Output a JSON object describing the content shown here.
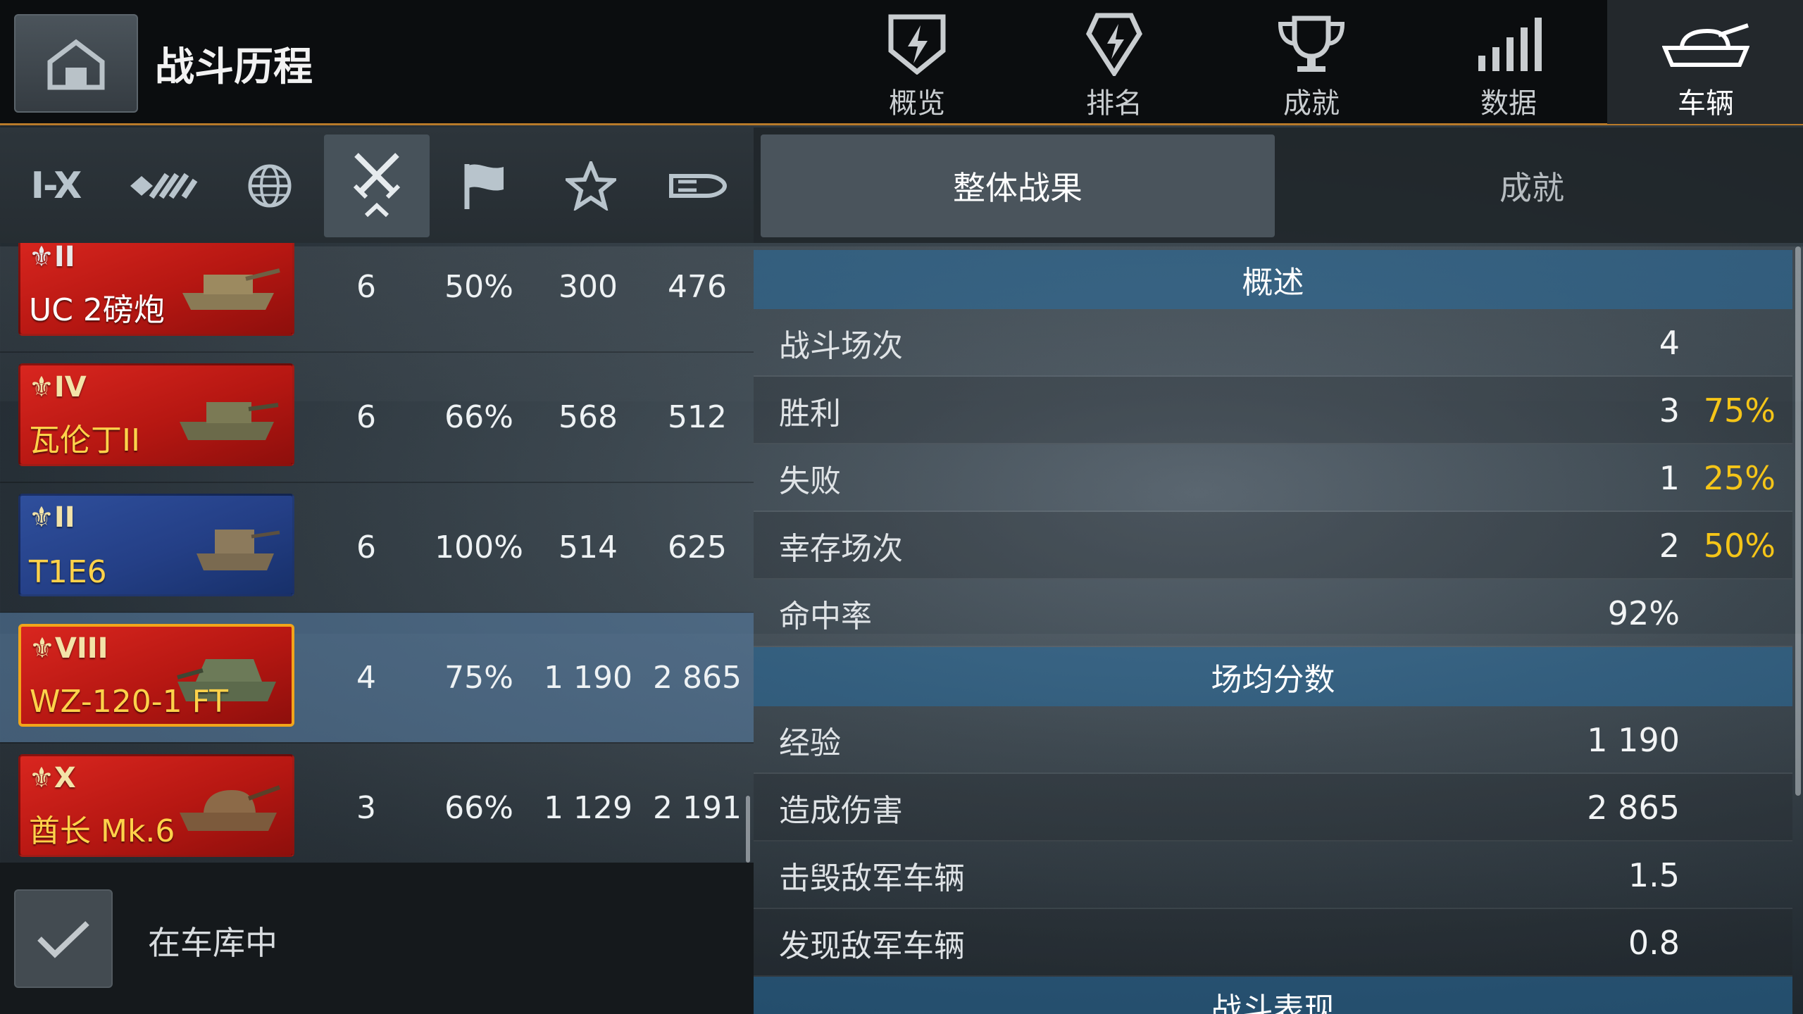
{
  "header": {
    "title": "战斗历程",
    "tabs": [
      {
        "label": "概览",
        "icon": "shield-bolt-icon",
        "active": false
      },
      {
        "label": "排名",
        "icon": "rank-bolt-icon",
        "active": false
      },
      {
        "label": "成就",
        "icon": "trophy-icon",
        "active": false
      },
      {
        "label": "数据",
        "icon": "bar-signal-icon",
        "active": false
      },
      {
        "label": "车辆",
        "icon": "tank-icon",
        "active": true
      }
    ]
  },
  "filters": {
    "tier_label": "I-X",
    "items": [
      "tier-filter",
      "vehicle-class-filter",
      "nation-filter",
      "battles-sort",
      "victories-sort",
      "mastery-sort",
      "damage-sort"
    ],
    "active": "battles-sort"
  },
  "right_tabs": {
    "overall": "整体战果",
    "achievements": "成就"
  },
  "vehicles": [
    {
      "tier": "II",
      "name": "UC 2磅炮",
      "battles": "6",
      "winrate": "50%",
      "xp": "300",
      "damage": "476",
      "flag": "red",
      "name_color": "white",
      "selected": false
    },
    {
      "tier": "IV",
      "name": "瓦伦丁II",
      "battles": "6",
      "winrate": "66%",
      "xp": "568",
      "damage": "512",
      "flag": "red",
      "name_color": "gold",
      "selected": false
    },
    {
      "tier": "II",
      "name": "T1E6",
      "battles": "6",
      "winrate": "100%",
      "xp": "514",
      "damage": "625",
      "flag": "blue",
      "name_color": "gold",
      "selected": false
    },
    {
      "tier": "VIII",
      "name": "WZ-120-1 FT",
      "battles": "4",
      "winrate": "75%",
      "xp": "1 190",
      "damage": "2 865",
      "flag": "red",
      "name_color": "gold",
      "selected": true
    },
    {
      "tier": "X",
      "name": "酋长 Mk.6",
      "battles": "3",
      "winrate": "66%",
      "xp": "1 129",
      "damage": "2 191",
      "flag": "red",
      "name_color": "gold",
      "selected": false
    }
  ],
  "garage": {
    "label": "在车库中",
    "checked": true
  },
  "stats": {
    "overview_title": "概述",
    "overview": [
      {
        "label": "战斗场次",
        "value": "4",
        "pct": ""
      },
      {
        "label": "胜利",
        "value": "3",
        "pct": "75%"
      },
      {
        "label": "失败",
        "value": "1",
        "pct": "25%"
      },
      {
        "label": "幸存场次",
        "value": "2",
        "pct": "50%"
      },
      {
        "label": "命中率",
        "value": "92%",
        "pct": ""
      }
    ],
    "average_title": "场均分数",
    "average": [
      {
        "label": "经验",
        "value": "1 190"
      },
      {
        "label": "造成伤害",
        "value": "2 865"
      },
      {
        "label": "击毁敌军车辆",
        "value": "1.5"
      },
      {
        "label": "发现敌军车辆",
        "value": "0.8"
      }
    ],
    "performance_title": "战斗表现"
  },
  "colors": {
    "accent": "#f5c518",
    "header_border": "#b87a2a",
    "selected_row": "#5a82aa",
    "section_head": "#286ea0"
  }
}
